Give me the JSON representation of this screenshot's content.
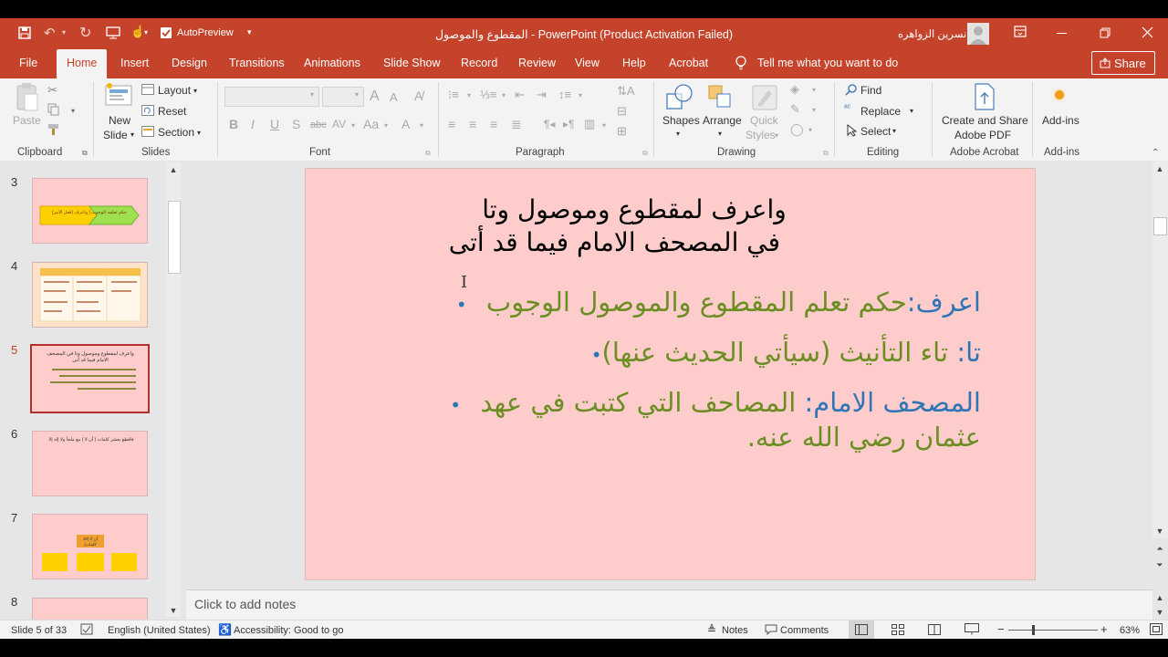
{
  "titlebar": {
    "autopreview_label": "AutoPreview",
    "title": "المقطوع والموصول  -  PowerPoint (Product Activation Failed)",
    "user_name": "نسرين الزواهره"
  },
  "tabs": [
    "File",
    "Home",
    "Insert",
    "Design",
    "Transitions",
    "Animations",
    "Slide Show",
    "Record",
    "Review",
    "View",
    "Help",
    "Acrobat"
  ],
  "tell_me": "Tell me what you want to do",
  "share_label": "Share",
  "ribbon": {
    "clipboard": {
      "paste": "Paste",
      "label": "Clipboard"
    },
    "slides": {
      "new_slide_1": "New",
      "new_slide_2": "Slide",
      "layout": "Layout",
      "reset": "Reset",
      "section": "Section",
      "label": "Slides"
    },
    "font": {
      "bold": "B",
      "italic": "I",
      "underline": "U",
      "strike": "S",
      "spacing": "abc",
      "case": "Aa",
      "color": "A",
      "grow": "A",
      "shrink": "A",
      "label": "Font"
    },
    "paragraph": {
      "label": "Paragraph"
    },
    "drawing": {
      "shapes": "Shapes",
      "arrange": "Arrange",
      "quick_styles_1": "Quick",
      "quick_styles_2": "Styles",
      "label": "Drawing"
    },
    "editing": {
      "find": "Find",
      "replace": "Replace",
      "select": "Select",
      "label": "Editing"
    },
    "adobe": {
      "line1": "Create and Share",
      "line2": "Adobe PDF",
      "label": "Adobe Acrobat"
    },
    "addins": {
      "button": "Add-ins",
      "label": "Add-ins"
    }
  },
  "thumbnails": [
    {
      "num": "3",
      "text": "حكم تعلمه الوجوب | واعرف (فعل الأمر)"
    },
    {
      "num": "4",
      "text": "جدول المقطوع والموصول"
    },
    {
      "num": "5",
      "text": "واعرف لمقطوع وموصول وتا في المصحف الامام فيما قد أتى"
    },
    {
      "num": "6",
      "text": "فاقطع بعشر كلمات ( أن لا ) مع ملجأ ولا إله إلا"
    },
    {
      "num": "7",
      "text": "أن لا (10 كلمات)"
    },
    {
      "num": "8",
      "text": ""
    }
  ],
  "slide": {
    "title_line1": "واعرف لمقطوع وموصول وتا",
    "title_line2": "في المصحف الامام فيما قد أتى",
    "b1_term": "اعرف:",
    "b1_def": "حكم تعلم المقطوع والموصول الوجوب",
    "b2_term": "تا:",
    "b2_def": " تاء التأنيث (سيأتي الحديث عنها)",
    "b3_term": "المصحف الامام:",
    "b3_def": " المصاحف التي كتبت في عهد",
    "b3_cont": "عثمان رضي الله عنه."
  },
  "notes_placeholder": "Click to add notes",
  "status": {
    "slide_of": "Slide 5 of 33",
    "language": "English (United States)",
    "accessibility": "Accessibility: Good to go",
    "notes": "Notes",
    "comments": "Comments",
    "zoom": "63%"
  },
  "colors": {
    "accent": "#c5432a",
    "term_blue": "#2e75b6",
    "def_green": "#6b8e23",
    "slide_bg": "#ffcccc"
  }
}
